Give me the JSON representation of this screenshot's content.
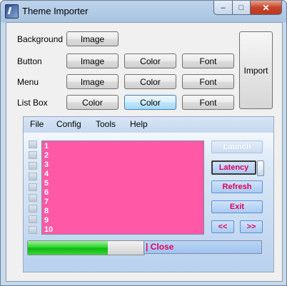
{
  "window": {
    "title": "Theme Importer"
  },
  "caption": {
    "minimize": "–",
    "maximize": "□",
    "close": "✕"
  },
  "rows": [
    {
      "label": "Background",
      "buttons": [
        "Image"
      ]
    },
    {
      "label": "Button",
      "buttons": [
        "Image",
        "Color",
        "Font"
      ]
    },
    {
      "label": "Menu",
      "buttons": [
        "Image",
        "Color",
        "Font"
      ]
    },
    {
      "label": "List Box",
      "buttons": [
        "Color",
        "Color",
        "Font"
      ]
    }
  ],
  "import_label": "Import",
  "preview": {
    "menu": [
      "File",
      "Config",
      "Tools",
      "Help"
    ],
    "list_items": [
      "1",
      "2",
      "3",
      "4",
      "5",
      "6",
      "7",
      "8",
      "9",
      "10"
    ],
    "buttons": {
      "launch": "Launch",
      "latency": "Latency",
      "refresh": "Refresh",
      "exit": "Exit",
      "prev": "<<",
      "next": ">>"
    },
    "progress_fraction": 0.69,
    "status_text": "| Close",
    "colors": {
      "listbox_bg": "#ff58a6",
      "accent_text": "#e3005a",
      "progress_green": "#2cd62c"
    }
  },
  "icons": {
    "app": "theme-importer-app-icon"
  }
}
